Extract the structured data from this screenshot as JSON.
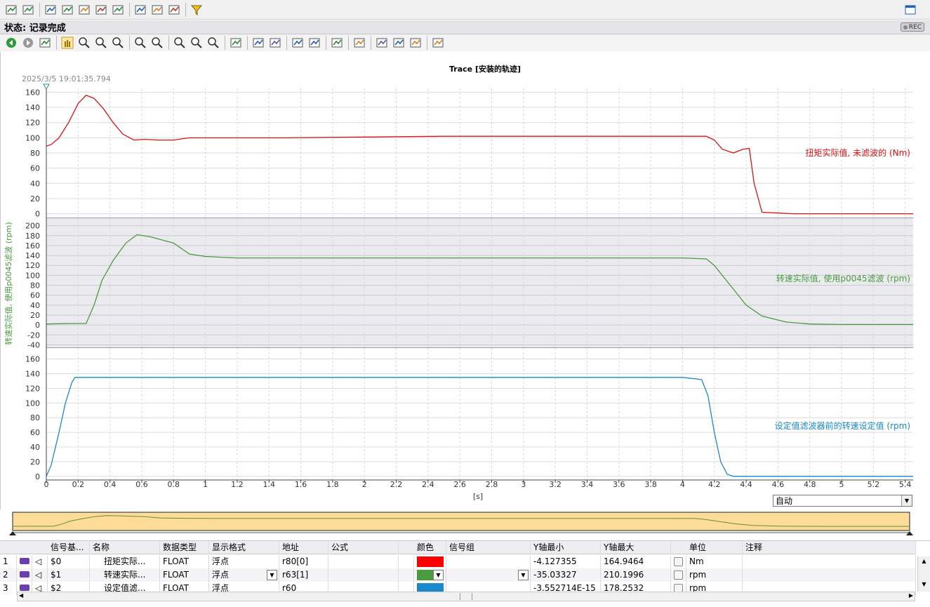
{
  "status": {
    "label": "状态: 记录完成",
    "rec": "REC"
  },
  "trace": {
    "timestamp": "2025/3/5 19:01:35.794",
    "title": "Trace [安装的轨迹]"
  },
  "time_axis": {
    "unit": "[s]",
    "mode": "自动"
  },
  "colors": {
    "torque": "#dd1111",
    "speed": "#4a9a40",
    "setpoint": "#1a88cc"
  },
  "toolbar1_icons": [
    "import-trace-icon",
    "export-trace-icon",
    "show-trace-icon",
    "record-trace-icon",
    "save-measurement-icon",
    "delete-measurement-icon",
    "refresh-icon",
    "add-measurement-icon",
    "upload-icon",
    "download-icon",
    "filter-icon"
  ],
  "toolbar2_icons": [
    "back-icon",
    "forward-icon",
    "history-icon",
    "pan-icon",
    "zoom-area-icon",
    "zoom-horizontal-icon",
    "zoom-vertical-icon",
    "zoom-in-icon",
    "zoom-out-icon",
    "zoom-fit-icon",
    "zoom-y-icon",
    "zoom-x-icon",
    "stacked-view-icon",
    "time-to-trigger-icon",
    "measure-cursor-icon",
    "diagonal-cursor-icon",
    "vertical-cursor-icon",
    "horizontal-cursor-icon",
    "fit-signals-icon",
    "list-icon",
    "align-left-icon",
    "align-right-icon",
    "export-data-icon"
  ],
  "chart_data": [
    {
      "type": "line",
      "ylabel": "",
      "ylim": [
        -5,
        165
      ],
      "yticks": [
        "0",
        "20",
        "40",
        "60",
        "80",
        "100",
        "120",
        "140",
        "160"
      ],
      "series": [
        {
          "name": "扭矩实际值, 未滤波的 (Nm)",
          "x": [
            0,
            0.03,
            0.08,
            0.14,
            0.2,
            0.25,
            0.3,
            0.36,
            0.42,
            0.48,
            0.55,
            0.62,
            0.7,
            0.8,
            0.9,
            1.0,
            1.2,
            1.5,
            2.0,
            2.5,
            3.0,
            3.5,
            4.0,
            4.15,
            4.2,
            4.25,
            4.32,
            4.38,
            4.42,
            4.45,
            4.5,
            4.7,
            5.0,
            5.45
          ],
          "values": [
            89,
            91,
            100,
            120,
            145,
            156,
            152,
            138,
            120,
            105,
            97,
            98,
            97,
            97,
            100,
            100,
            100,
            100,
            101,
            102,
            102,
            102,
            102,
            102,
            97,
            85,
            80,
            85,
            86,
            40,
            2,
            0,
            0,
            0
          ]
        }
      ],
      "legend": "right"
    },
    {
      "type": "line",
      "ylabel": "转速实际值, 使用p0045滤波 (rpm)",
      "ylim": [
        -45,
        215
      ],
      "yticks": [
        "-40",
        "-20",
        "0",
        "20",
        "40",
        "60",
        "80",
        "100",
        "120",
        "140",
        "160",
        "180",
        "200"
      ],
      "series": [
        {
          "name": "转速实际值, 使用p0045滤波 (rpm)",
          "x": [
            0,
            0.15,
            0.25,
            0.3,
            0.35,
            0.42,
            0.5,
            0.57,
            0.65,
            0.8,
            0.9,
            1.0,
            1.2,
            2.0,
            3.0,
            4.0,
            4.15,
            4.2,
            4.3,
            4.4,
            4.5,
            4.65,
            4.8,
            5.0,
            5.45
          ],
          "values": [
            2,
            3,
            3,
            40,
            90,
            130,
            165,
            182,
            178,
            165,
            143,
            138,
            135,
            135,
            135,
            135,
            133,
            120,
            80,
            40,
            18,
            6,
            2,
            1,
            1
          ]
        }
      ],
      "legend": "right"
    },
    {
      "type": "line",
      "ylabel": "",
      "ylim": [
        -5,
        175
      ],
      "yticks": [
        "0",
        "20",
        "40",
        "60",
        "80",
        "100",
        "120",
        "140",
        "160"
      ],
      "series": [
        {
          "name": "设定值滤波器前的转速设定值 (rpm)",
          "x": [
            0,
            0.03,
            0.08,
            0.12,
            0.16,
            0.18,
            0.2,
            1.0,
            2.0,
            3.0,
            4.0,
            4.12,
            4.16,
            4.2,
            4.24,
            4.28,
            4.32,
            5.45
          ],
          "values": [
            0,
            15,
            60,
            100,
            128,
            135,
            135,
            135,
            135,
            135,
            135,
            132,
            110,
            60,
            20,
            3,
            0,
            0
          ]
        }
      ],
      "legend": "right"
    }
  ],
  "x_axis": {
    "ticks": [
      "0",
      "0.2",
      "0.4",
      "0.6",
      "0.8",
      "1",
      "1.2",
      "1.4",
      "1.6",
      "1.8",
      "2",
      "2.2",
      "2.4",
      "2.6",
      "2.8",
      "3",
      "3.2",
      "3.4",
      "3.6",
      "3.8",
      "4",
      "4.2",
      "4.4",
      "4.6",
      "4.8",
      "5",
      "5.2",
      "5.4"
    ],
    "xlim": [
      0,
      5.45
    ]
  },
  "table": {
    "headers": [
      "信号基...",
      "名称",
      "数据类型",
      "显示格式",
      "地址",
      "公式",
      "颜色",
      "信号组",
      "Y轴最小",
      "Y轴最大",
      "单位",
      "注释"
    ],
    "rows": [
      {
        "index": "1",
        "id": "$0",
        "name": "扭矩实际...",
        "type": "FLOAT",
        "format": "浮点",
        "address": "r80[0]",
        "ymin": "-4.127355",
        "ymax": "164.9464",
        "unit": "Nm",
        "color": "#ff0000"
      },
      {
        "index": "2",
        "id": "$1",
        "name": "转速实际...",
        "type": "FLOAT",
        "format": "浮点",
        "address": "r63[1]",
        "ymin": "-35.03327",
        "ymax": "210.1996",
        "unit": "rpm",
        "color": "#4a9a40"
      },
      {
        "index": "3",
        "id": "$2",
        "name": "设定值滤...",
        "type": "FLOAT",
        "format": "浮点",
        "address": "r60",
        "ymin": "-3.552714E-15",
        "ymax": "178.2532",
        "unit": "rpm",
        "color": "#1a88cc"
      }
    ]
  }
}
